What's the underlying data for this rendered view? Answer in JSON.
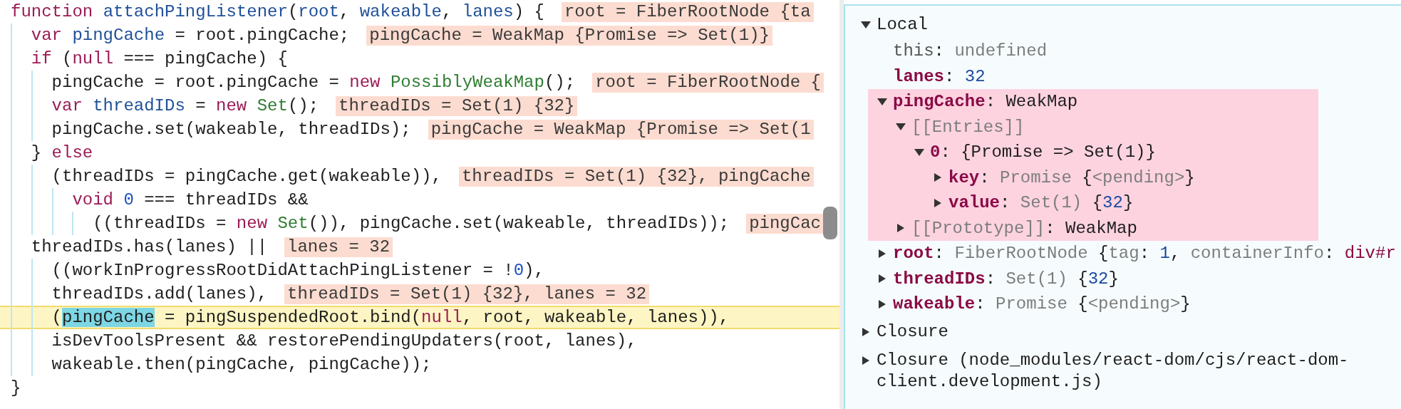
{
  "code": {
    "lines": [
      {
        "current": false,
        "tokens": [
          {
            "kind": "keyword",
            "text": "function "
          },
          {
            "kind": "def",
            "text": "attachPingListener"
          },
          {
            "kind": "plain",
            "text": "("
          },
          {
            "kind": "def",
            "text": "root"
          },
          {
            "kind": "plain",
            "text": ", "
          },
          {
            "kind": "def",
            "text": "wakeable"
          },
          {
            "kind": "plain",
            "text": ", "
          },
          {
            "kind": "def",
            "text": "lanes"
          },
          {
            "kind": "plain",
            "text": ") {"
          }
        ],
        "inline_value": "root = FiberRootNode {ta"
      },
      {
        "current": false,
        "tokens": [
          {
            "kind": "keyword",
            "text": "  var "
          },
          {
            "kind": "def",
            "text": "pingCache"
          },
          {
            "kind": "plain",
            "text": " = root.pingCache;"
          }
        ],
        "inline_value": "pingCache = WeakMap {Promise => Set(1)}"
      },
      {
        "current": false,
        "tokens": [
          {
            "kind": "keyword",
            "text": "  if"
          },
          {
            "kind": "plain",
            "text": " ("
          },
          {
            "kind": "keyword",
            "text": "null"
          },
          {
            "kind": "plain",
            "text": " === pingCache) {"
          }
        ]
      },
      {
        "current": false,
        "tokens": [
          {
            "kind": "plain",
            "text": "    pingCache = root.pingCache = "
          },
          {
            "kind": "keyword",
            "text": "new "
          },
          {
            "kind": "type",
            "text": "PossiblyWeakMap"
          },
          {
            "kind": "plain",
            "text": "();"
          }
        ],
        "inline_value": "root = FiberRootNode {"
      },
      {
        "current": false,
        "tokens": [
          {
            "kind": "keyword",
            "text": "    var "
          },
          {
            "kind": "def",
            "text": "threadIDs"
          },
          {
            "kind": "plain",
            "text": " = "
          },
          {
            "kind": "keyword",
            "text": "new "
          },
          {
            "kind": "type",
            "text": "Set"
          },
          {
            "kind": "plain",
            "text": "();"
          }
        ],
        "inline_value": "threadIDs = Set(1) {32}"
      },
      {
        "current": false,
        "tokens": [
          {
            "kind": "plain",
            "text": "    pingCache.set(wakeable, threadIDs);"
          }
        ],
        "inline_value": "pingCache = WeakMap {Promise => Set(1"
      },
      {
        "current": false,
        "tokens": [
          {
            "kind": "plain",
            "text": "  } "
          },
          {
            "kind": "keyword",
            "text": "else"
          }
        ]
      },
      {
        "current": false,
        "tokens": [
          {
            "kind": "plain",
            "text": "    (threadIDs = pingCache.get(wakeable)),"
          }
        ],
        "inline_value": "threadIDs = Set(1) {32}, pingCache"
      },
      {
        "current": false,
        "tokens": [
          {
            "kind": "keyword",
            "text": "      void "
          },
          {
            "kind": "num",
            "text": "0"
          },
          {
            "kind": "plain",
            "text": " === threadIDs &&"
          }
        ]
      },
      {
        "current": false,
        "tokens": [
          {
            "kind": "plain",
            "text": "        ((threadIDs = "
          },
          {
            "kind": "keyword",
            "text": "new "
          },
          {
            "kind": "type",
            "text": "Set"
          },
          {
            "kind": "plain",
            "text": "()), pingCache.set(wakeable, threadIDs));"
          }
        ],
        "inline_value": "pingCac"
      },
      {
        "current": false,
        "tokens": [
          {
            "kind": "plain",
            "text": "  threadIDs.has(lanes) ||"
          }
        ],
        "inline_value": "lanes = 32"
      },
      {
        "current": false,
        "tokens": [
          {
            "kind": "plain",
            "text": "    ((workInProgressRootDidAttachPingListener = !"
          },
          {
            "kind": "num",
            "text": "0"
          },
          {
            "kind": "plain",
            "text": "),"
          }
        ]
      },
      {
        "current": false,
        "tokens": [
          {
            "kind": "plain",
            "text": "    threadIDs.add(lanes),"
          }
        ],
        "inline_value": "threadIDs = Set(1) {32}, lanes = 32"
      },
      {
        "current": true,
        "tokens": [
          {
            "kind": "plain",
            "text": "    ("
          },
          {
            "kind": "match",
            "text": "pingCache"
          },
          {
            "kind": "plain",
            "text": " = pingSuspendedRoot.bind("
          },
          {
            "kind": "keyword",
            "text": "null"
          },
          {
            "kind": "plain",
            "text": ", root, wakeable, lanes)),"
          }
        ]
      },
      {
        "current": false,
        "tokens": [
          {
            "kind": "plain",
            "text": "    isDevToolsPresent && restorePendingUpdaters(root, lanes),"
          }
        ]
      },
      {
        "current": false,
        "tokens": [
          {
            "kind": "plain",
            "text": "    wakeable.then(pingCache, pingCache));"
          }
        ]
      },
      {
        "current": false,
        "tokens": [
          {
            "kind": "plain",
            "text": "}"
          }
        ]
      }
    ]
  },
  "scope": {
    "sections": [
      {
        "label": "Local",
        "expanded": true,
        "children": [
          {
            "highlighted": false,
            "tokens": [
              {
                "kind": "this",
                "text": "this"
              },
              {
                "kind": "plain",
                "text": ": "
              },
              {
                "kind": "dim",
                "text": "undefined"
              }
            ]
          },
          {
            "highlighted": false,
            "tokens": [
              {
                "kind": "key",
                "text": "lanes"
              },
              {
                "kind": "plain",
                "text": ": "
              },
              {
                "kind": "num",
                "text": "32"
              }
            ]
          },
          {
            "highlighted": true,
            "expanded": true,
            "tokens": [
              {
                "kind": "key",
                "text": "pingCache"
              },
              {
                "kind": "plain",
                "text": ": WeakMap"
              }
            ],
            "children": [
              {
                "expanded": true,
                "tokens": [
                  {
                    "kind": "dim",
                    "text": "[[Entries]]"
                  }
                ],
                "children": [
                  {
                    "expanded": true,
                    "tokens": [
                      {
                        "kind": "key",
                        "text": "0"
                      },
                      {
                        "kind": "plain",
                        "text": ": {Promise => Set(1)}"
                      }
                    ],
                    "children": [
                      {
                        "expanded": false,
                        "tokens": [
                          {
                            "kind": "key",
                            "text": "key"
                          },
                          {
                            "kind": "plain",
                            "text": ": "
                          },
                          {
                            "kind": "dim",
                            "text": "Promise "
                          },
                          {
                            "kind": "plain",
                            "text": "{"
                          },
                          {
                            "kind": "dim",
                            "text": "<pending>"
                          },
                          {
                            "kind": "plain",
                            "text": "}"
                          }
                        ]
                      },
                      {
                        "expanded": false,
                        "tokens": [
                          {
                            "kind": "key",
                            "text": "value"
                          },
                          {
                            "kind": "plain",
                            "text": ": "
                          },
                          {
                            "kind": "dim",
                            "text": "Set(1) "
                          },
                          {
                            "kind": "plain",
                            "text": "{"
                          },
                          {
                            "kind": "num",
                            "text": "32"
                          },
                          {
                            "kind": "plain",
                            "text": "}"
                          }
                        ]
                      }
                    ]
                  }
                ]
              },
              {
                "expanded": false,
                "tokens": [
                  {
                    "kind": "dim",
                    "text": "[[Prototype]]"
                  },
                  {
                    "kind": "plain",
                    "text": ": WeakMap"
                  }
                ]
              }
            ]
          },
          {
            "highlighted": false,
            "expanded": false,
            "tokens": [
              {
                "kind": "key",
                "text": "root"
              },
              {
                "kind": "plain",
                "text": ": "
              },
              {
                "kind": "dim",
                "text": "FiberRootNode "
              },
              {
                "kind": "plain",
                "text": "{"
              },
              {
                "kind": "dim",
                "text": "tag"
              },
              {
                "kind": "plain",
                "text": ": "
              },
              {
                "kind": "num",
                "text": "1"
              },
              {
                "kind": "plain",
                "text": ", "
              },
              {
                "kind": "dim",
                "text": "containerInfo"
              },
              {
                "kind": "plain",
                "text": ": "
              },
              {
                "kind": "tag",
                "text": "div#r"
              }
            ]
          },
          {
            "highlighted": false,
            "expanded": false,
            "tokens": [
              {
                "kind": "key",
                "text": "threadIDs"
              },
              {
                "kind": "plain",
                "text": ": "
              },
              {
                "kind": "dim",
                "text": "Set(1) "
              },
              {
                "kind": "plain",
                "text": "{"
              },
              {
                "kind": "num",
                "text": "32"
              },
              {
                "kind": "plain",
                "text": "}"
              }
            ]
          },
          {
            "highlighted": false,
            "expanded": false,
            "tokens": [
              {
                "kind": "key",
                "text": "wakeable"
              },
              {
                "kind": "plain",
                "text": ": "
              },
              {
                "kind": "dim",
                "text": "Promise "
              },
              {
                "kind": "plain",
                "text": "{"
              },
              {
                "kind": "dim",
                "text": "<pending>"
              },
              {
                "kind": "plain",
                "text": "}"
              }
            ]
          }
        ]
      },
      {
        "label": "Closure",
        "expanded": false
      },
      {
        "label": "Closure (node_modules/react-dom/cjs/react-dom-client.development.js)",
        "expanded": false
      }
    ]
  }
}
